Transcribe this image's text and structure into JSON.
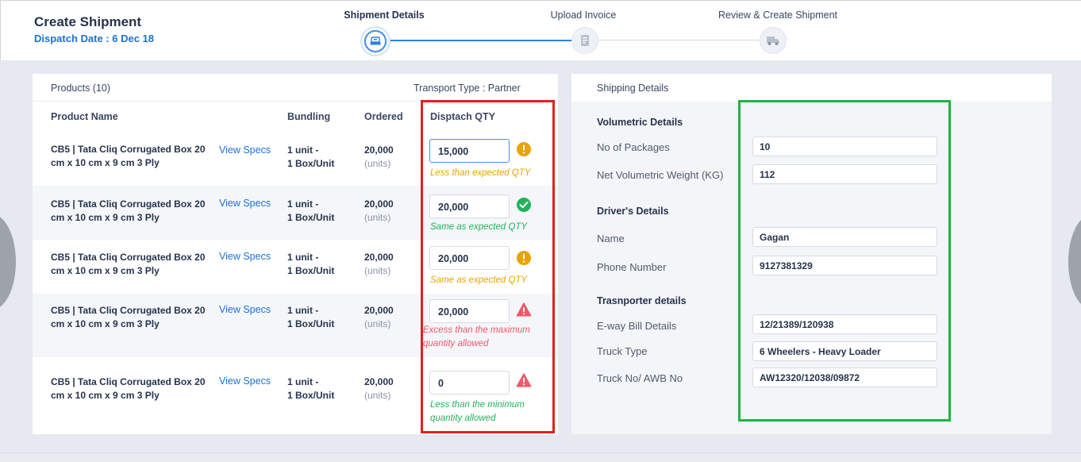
{
  "header": {
    "title": "Create Shipment",
    "dispatch_date": "Dispatch Date : 6 Dec 18"
  },
  "stepper": {
    "steps": [
      {
        "label": "Shipment Details",
        "icon": "shipment-icon",
        "active": true
      },
      {
        "label": "Upload Invoice",
        "icon": "invoice-icon",
        "active": false
      },
      {
        "label": "Review & Create Shipment",
        "icon": "truck-icon",
        "active": false
      }
    ]
  },
  "products": {
    "title": "Products (10)",
    "transport": "Transport Type : Partner",
    "columns": [
      "Product Name",
      "Bundling",
      "Ordered",
      "Disptach QTY"
    ],
    "rows": [
      {
        "name": "CB5 | Tata Cliq Corrugated Box 20 cm x 10 cm x 9 cm 3 Ply",
        "specs": "View Specs",
        "bundling_1": "1 unit -",
        "bundling_2": "1 Box/Unit",
        "ordered": "20,000",
        "units": "(units)",
        "qty": "15,000",
        "status": "warning",
        "msg_1": "Less than expected QTY",
        "msg_2": ""
      },
      {
        "name": "CB5 | Tata Cliq Corrugated Box 20 cm x 10 cm x 9 cm 3 Ply",
        "specs": "View Specs",
        "bundling_1": "1 unit -",
        "bundling_2": "1 Box/Unit",
        "ordered": "20,000",
        "units": "(units)",
        "qty": "20,000",
        "status": "success",
        "msg_1": "Same as expected QTY",
        "msg_2": ""
      },
      {
        "name": "CB5 | Tata Cliq Corrugated Box 20 cm x 10 cm x 9 cm 3 Ply",
        "specs": "View Specs",
        "bundling_1": "1 unit -",
        "bundling_2": "1 Box/Unit",
        "ordered": "20,000",
        "units": "(units)",
        "qty": "20,000",
        "status": "warning",
        "msg_1": "Same as expected QTY",
        "msg_2": ""
      },
      {
        "name": "CB5 | Tata Cliq Corrugated Box 20 cm x 10 cm x 9 cm 3 Ply",
        "specs": "View Specs",
        "bundling_1": "1 unit -",
        "bundling_2": "1 Box/Unit",
        "ordered": "20,000",
        "units": "(units)",
        "qty": "20,000",
        "status": "error",
        "msg_1": "Excess than the maximum",
        "msg_2": "quantity allowed"
      },
      {
        "name": "CB5 | Tata Cliq Corrugated Box 20 cm x 10 cm x 9 cm 3 Ply",
        "specs": "View Specs",
        "bundling_1": "1 unit -",
        "bundling_2": "1 Box/Unit",
        "ordered": "20,000",
        "units": "(units)",
        "qty": "0",
        "status": "error",
        "msg_1": "Less than the minimum",
        "msg_2": "quantity allowed"
      }
    ]
  },
  "shipping": {
    "title": "Shipping Details",
    "volumetric_title": "Volumetric Details",
    "packages_label": "No of Packages",
    "packages_value": "10",
    "weight_label": "Net Volumetric Weight (KG)",
    "weight_value": "112",
    "driver_title": "Driver's Details",
    "name_label": "Name",
    "name_value": "Gagan",
    "phone_label": "Phone Number",
    "phone_value": "9127381329",
    "transporter_title": "Trasnporter details",
    "eway_label": "E-way Bill Details",
    "eway_value": "12/21389/120938",
    "truck_type_label": "Truck Type",
    "truck_type_value": "6 Wheelers - Heavy Loader",
    "truck_no_label": "Truck No/ AWB No",
    "truck_no_value": "AW12320/12038/09872"
  },
  "colors": {
    "accent": "#1f6fd1",
    "warning": "#e8a400",
    "success": "#21b35c",
    "error": "#f0596a",
    "highlight_red": "#e02020",
    "highlight_green": "#1eb446"
  }
}
